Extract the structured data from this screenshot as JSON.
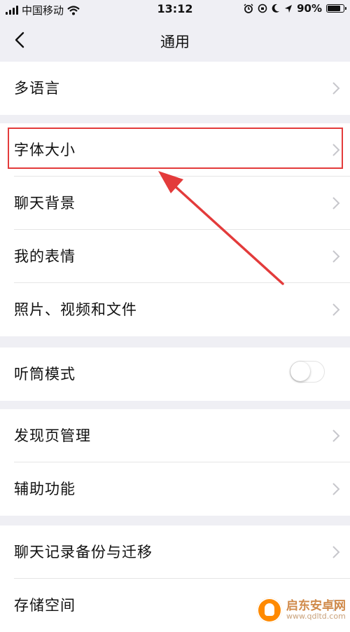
{
  "status_bar": {
    "carrier": "中国移动",
    "time": "13:12",
    "battery_pct": "90%",
    "battery_level": 0.9,
    "icons": [
      "signal-icon",
      "wifi-icon",
      "alarm-icon",
      "orientation-lock-icon",
      "moon-icon",
      "location-icon",
      "battery-icon"
    ]
  },
  "nav": {
    "title": "通用",
    "back_icon": "chevron-left-icon"
  },
  "groups": [
    {
      "items": [
        {
          "label": "多语言"
        }
      ]
    },
    {
      "items": [
        {
          "label": "字体大小",
          "highlighted": true
        },
        {
          "label": "聊天背景"
        },
        {
          "label": "我的表情"
        },
        {
          "label": "照片、视频和文件"
        }
      ]
    },
    {
      "items": [
        {
          "label": "听筒模式",
          "toggle": false
        }
      ]
    },
    {
      "items": [
        {
          "label": "发现页管理"
        },
        {
          "label": "辅助功能"
        }
      ]
    },
    {
      "items": [
        {
          "label": "聊天记录备份与迁移"
        },
        {
          "label": "存储空间"
        }
      ]
    }
  ],
  "annotation": {
    "color": "#e33b3b"
  },
  "watermark": {
    "name": "启东安卓网",
    "url": "www.qdltd.com"
  }
}
